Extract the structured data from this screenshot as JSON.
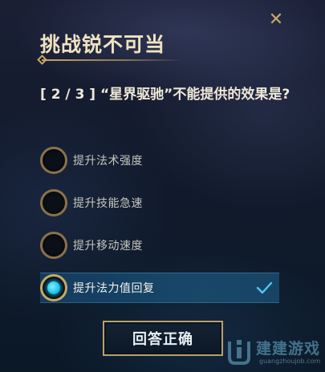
{
  "dialog": {
    "title": "挑战锐不可当",
    "close_icon": "close-icon",
    "question": "[ 2 / 3 ] “星界驱驰”不能提供的效果是?"
  },
  "options": [
    {
      "label": "提升法术强度",
      "selected": false
    },
    {
      "label": "提升技能急速",
      "selected": false
    },
    {
      "label": "提升移动速度",
      "selected": false
    },
    {
      "label": "提升法力值回复",
      "selected": true
    }
  ],
  "submit": {
    "label": "回答正确"
  },
  "watermark": {
    "text": "建建游戏",
    "sub": "guangzhoujob.com"
  },
  "colors": {
    "gold": "#c9a864",
    "selected_bg": "#1a4b6e",
    "radio_fill": "#1fc2ee",
    "check": "#4fc8f0"
  }
}
